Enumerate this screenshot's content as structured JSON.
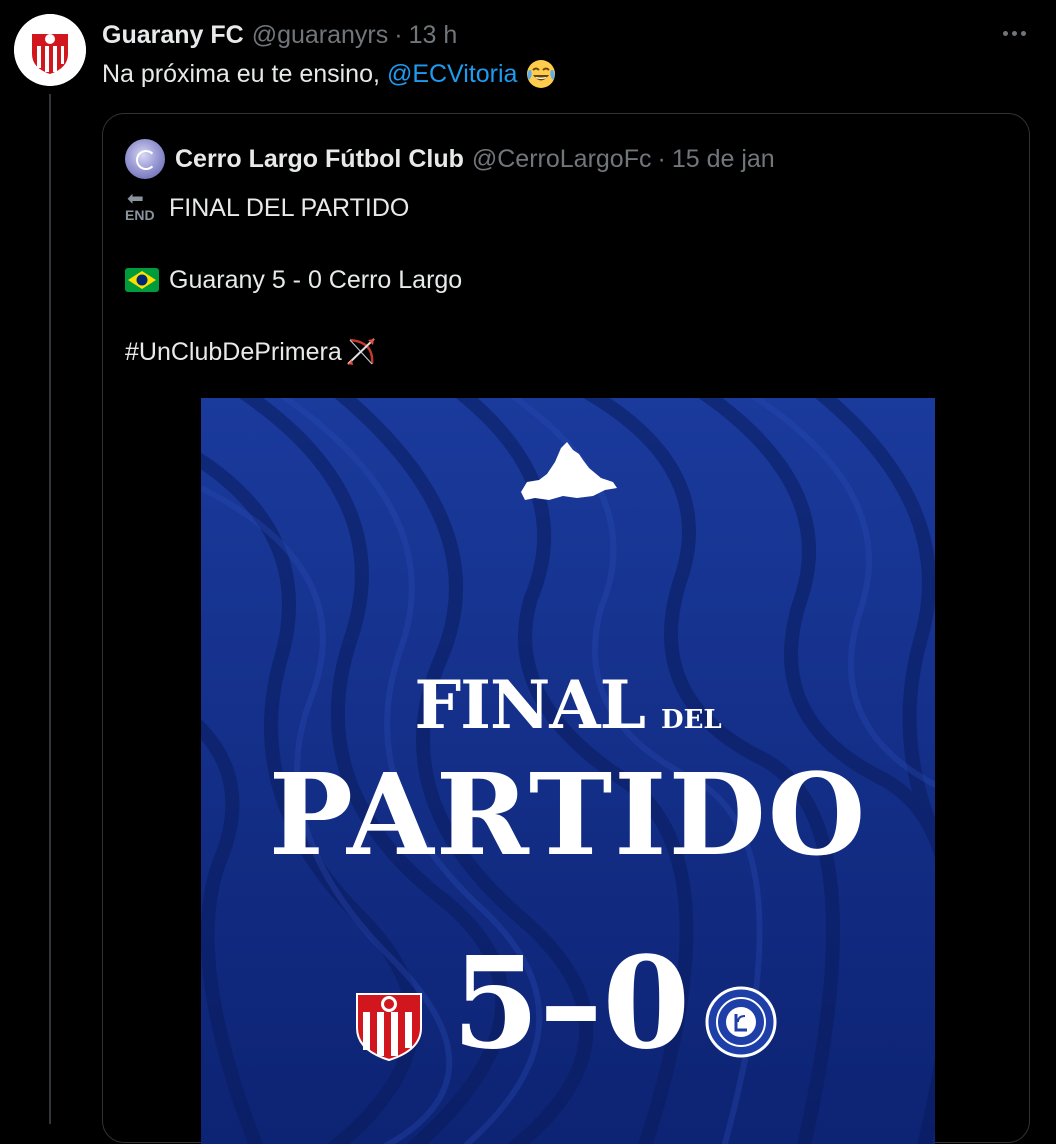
{
  "tweet": {
    "display_name": "Guarany FC",
    "handle": "@guaranyrs",
    "separator": "·",
    "time": "13 h",
    "text": "Na próxima eu te ensino,",
    "mention": "@ECVitoria",
    "emoji": "face-with-tears-of-joy"
  },
  "quote": {
    "display_name": "Cerro Largo Fútbol Club",
    "handle": "@CerroLargoFc",
    "separator": "·",
    "date": "15 de jan",
    "end_icon_label": "END",
    "line1": "FINAL DEL PARTIDO",
    "line2": "Guarany 5 - 0 Cerro Largo",
    "line3": "#UnClubDePrimera"
  },
  "poster": {
    "title_big": "FINAL",
    "title_small": "DEL",
    "title_main": "PARTIDO",
    "score": "5–0",
    "background_color": "#0f2a82"
  },
  "colors": {
    "background": "#000000",
    "text": "#e7e9ea",
    "muted": "#71767b",
    "link": "#1d9bf0",
    "border": "#2f3336"
  }
}
